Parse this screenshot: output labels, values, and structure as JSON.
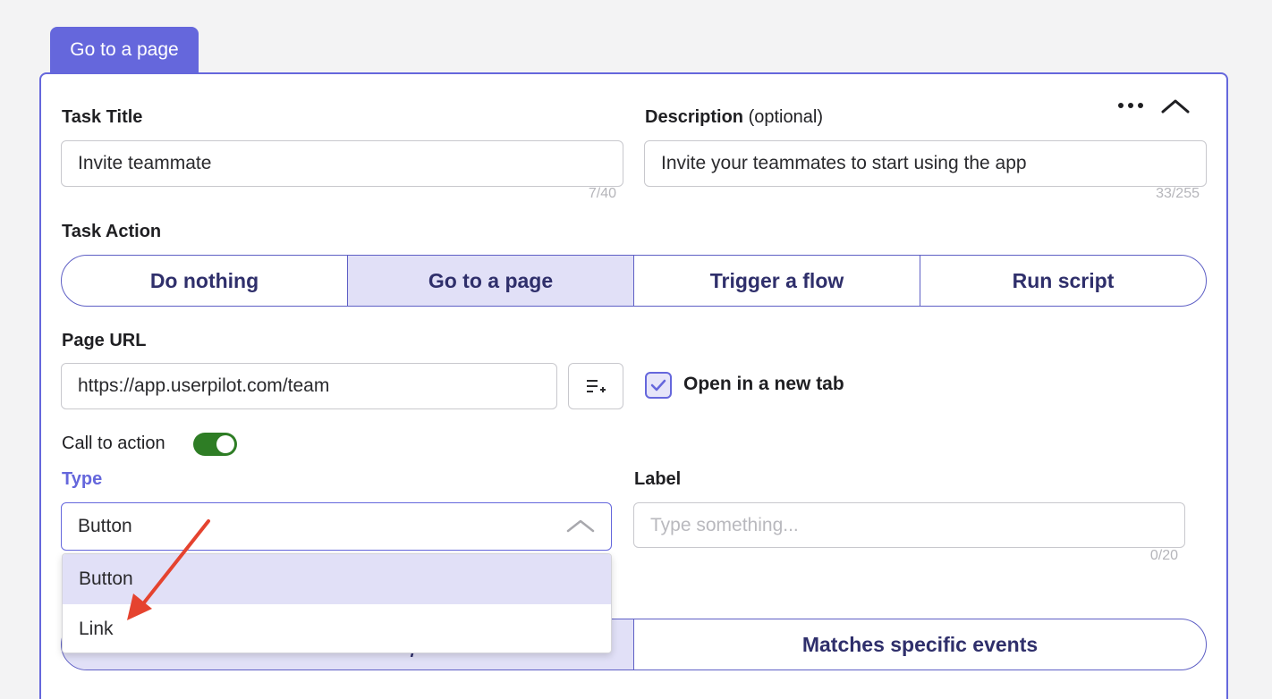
{
  "tab": {
    "label": "Go to a page"
  },
  "task_title": {
    "label": "Task Title",
    "value": "Invite teammate",
    "counter": "7/40"
  },
  "description": {
    "label": "Description",
    "label_suffix": "(optional)",
    "value": "Invite your teammates to start using the app",
    "counter": "33/255"
  },
  "task_action": {
    "label": "Task Action",
    "options": [
      "Do nothing",
      "Go to a page",
      "Trigger a flow",
      "Run script"
    ],
    "selected": "Go to a page"
  },
  "page_url": {
    "label": "Page URL",
    "value": "https://app.userpilot.com/team"
  },
  "open_new_tab": {
    "label": "Open in a new tab",
    "checked": true
  },
  "call_to_action": {
    "label": "Call to action",
    "enabled": true
  },
  "type": {
    "label": "Type",
    "value": "Button",
    "options": [
      "Button",
      "Link"
    ],
    "highlighted": "Button"
  },
  "cta_label": {
    "label": "Label",
    "placeholder": "Type something...",
    "counter": "0/20"
  },
  "completion": {
    "options": [
      "",
      "Matches specific events"
    ],
    "selected_index": 0
  },
  "colors": {
    "accent": "#6567dc",
    "selected_bg": "#e1e0f7",
    "toggle_on": "#2e7d25",
    "annotation_arrow": "#e5432f"
  },
  "icons": {
    "more": "more-horizontal-icon",
    "collapse": "chevron-up-icon",
    "insert_variable": "list-add-icon",
    "check": "check-icon",
    "select_chevron": "chevron-up-icon",
    "annotation": "red-arrow-icon"
  }
}
